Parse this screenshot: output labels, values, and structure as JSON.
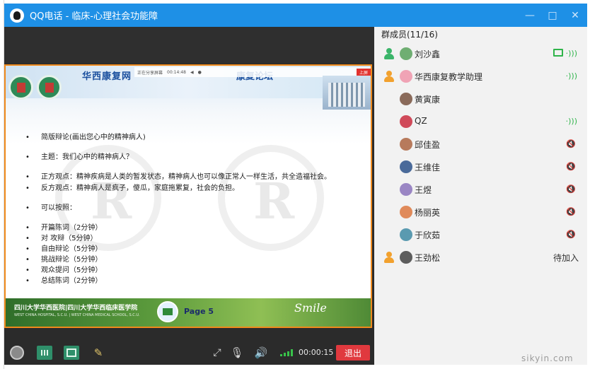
{
  "window": {
    "title": "QQ电话 - 临床-心理社会功能障"
  },
  "slide": {
    "brand_left": "华西康复网",
    "brand_right": "康复论坛",
    "share_bar": {
      "label": "正在分享屏幕",
      "time": "00:14:48",
      "stop_label": "上屏"
    },
    "bullets": [
      "简版辩论(画出您心中的精神病人)",
      "主题：我们心中的精神病人？",
      "正方观点：精神疾病是人类的暂发状态，精神病人也可以像正常人一样生活，共全造福社会。",
      "反方观点：精神病人是疯子，傻瓜，家庭拖累复，社会的负担。",
      "可以按照：",
      "开篇陈词（2分钟）",
      "对   攻辩（5分钟）",
      "自由辩论（5分钟）",
      "挑战辩论（5分钟）",
      "观众提问（5分钟）",
      "总结陈词（2分钟）"
    ],
    "footer_logo_cn": "四川大学华西医院|四川大学华西临床医学院",
    "footer_logo_en": "WEST CHINA HOSPITAL, S.C.U. | WEST CHINA MEDICAL SCHOOL, S.C.U.",
    "page_label": "Page  5",
    "signature": "Smile"
  },
  "toolbar": {
    "timer": "00:00:15",
    "exit_label": "退出"
  },
  "members": {
    "title": "群成员(11/16)",
    "list": [
      {
        "name": "刘沙鑫",
        "role": "admin",
        "status": "speaking",
        "sharing": true
      },
      {
        "name": "华西康复教学助理",
        "role": "owner",
        "status": "speaking",
        "sharing": false
      },
      {
        "name": "黄寅康",
        "role": "none",
        "status": "none",
        "sharing": false
      },
      {
        "name": "QZ",
        "role": "none",
        "status": "speaking",
        "sharing": false
      },
      {
        "name": "邱佳盈",
        "role": "none",
        "status": "muted",
        "sharing": false
      },
      {
        "name": "王维佳",
        "role": "none",
        "status": "muted",
        "sharing": false
      },
      {
        "name": "王煜",
        "role": "none",
        "status": "muted",
        "sharing": false
      },
      {
        "name": "杨丽英",
        "role": "none",
        "status": "muted",
        "sharing": false
      },
      {
        "name": "于欣茹",
        "role": "none",
        "status": "muted",
        "sharing": false
      },
      {
        "name": "王劲松",
        "role": "none",
        "status": "pending",
        "status_text": "待加入",
        "sharing": false
      }
    ]
  },
  "watermark": "sikyin.com",
  "colors": {
    "titlebar": "#1e90e6",
    "exit": "#e0393e",
    "speaking": "#2fb44a",
    "muted": "#e27b7b",
    "slide_border": "#f08a1c"
  }
}
